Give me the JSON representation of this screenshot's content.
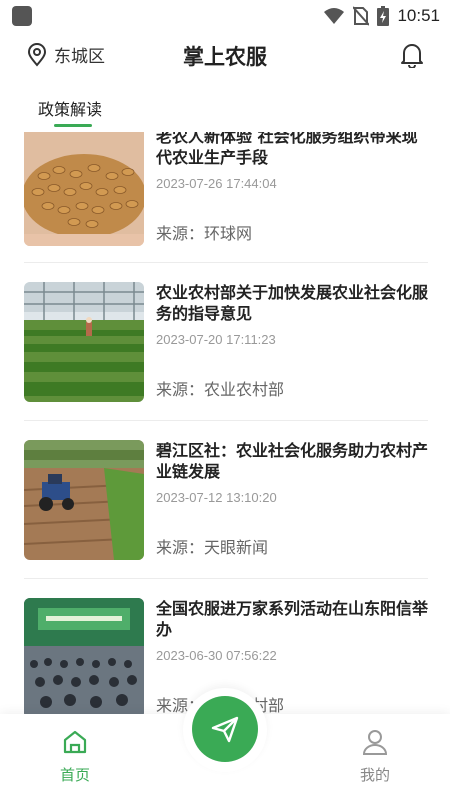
{
  "status_bar": {
    "time": "10:51"
  },
  "header": {
    "location": "东城区",
    "title": "掌上农服"
  },
  "tabs": [
    {
      "label": "政策解读",
      "active": true
    }
  ],
  "articles": [
    {
      "title": "老农人新体验 社会化服务组织带来现代农业生产手段",
      "date": "2023-07-26 17:44:04",
      "source": "来源：环球网",
      "image": "wheat-grains"
    },
    {
      "title": "农业农村部关于加快发展农业社会化服务的指导意见",
      "date": "2023-07-20 17:11:23",
      "source": "来源：农业农村部",
      "image": "greenhouse"
    },
    {
      "title": "碧江区社：农业社会化服务助力农村产业链发展",
      "date": "2023-07-12 13:10:20",
      "source": "来源：天眼新闻",
      "image": "tractor-field"
    },
    {
      "title": "全国农服进万家系列活动在山东阳信举办",
      "date": "2023-06-30 07:56:22",
      "source": "来源：农业农村部",
      "image": "conference-hall"
    }
  ],
  "bottom_nav": {
    "home": "首页",
    "mine": "我的"
  },
  "colors": {
    "accent": "#3aaa55"
  }
}
